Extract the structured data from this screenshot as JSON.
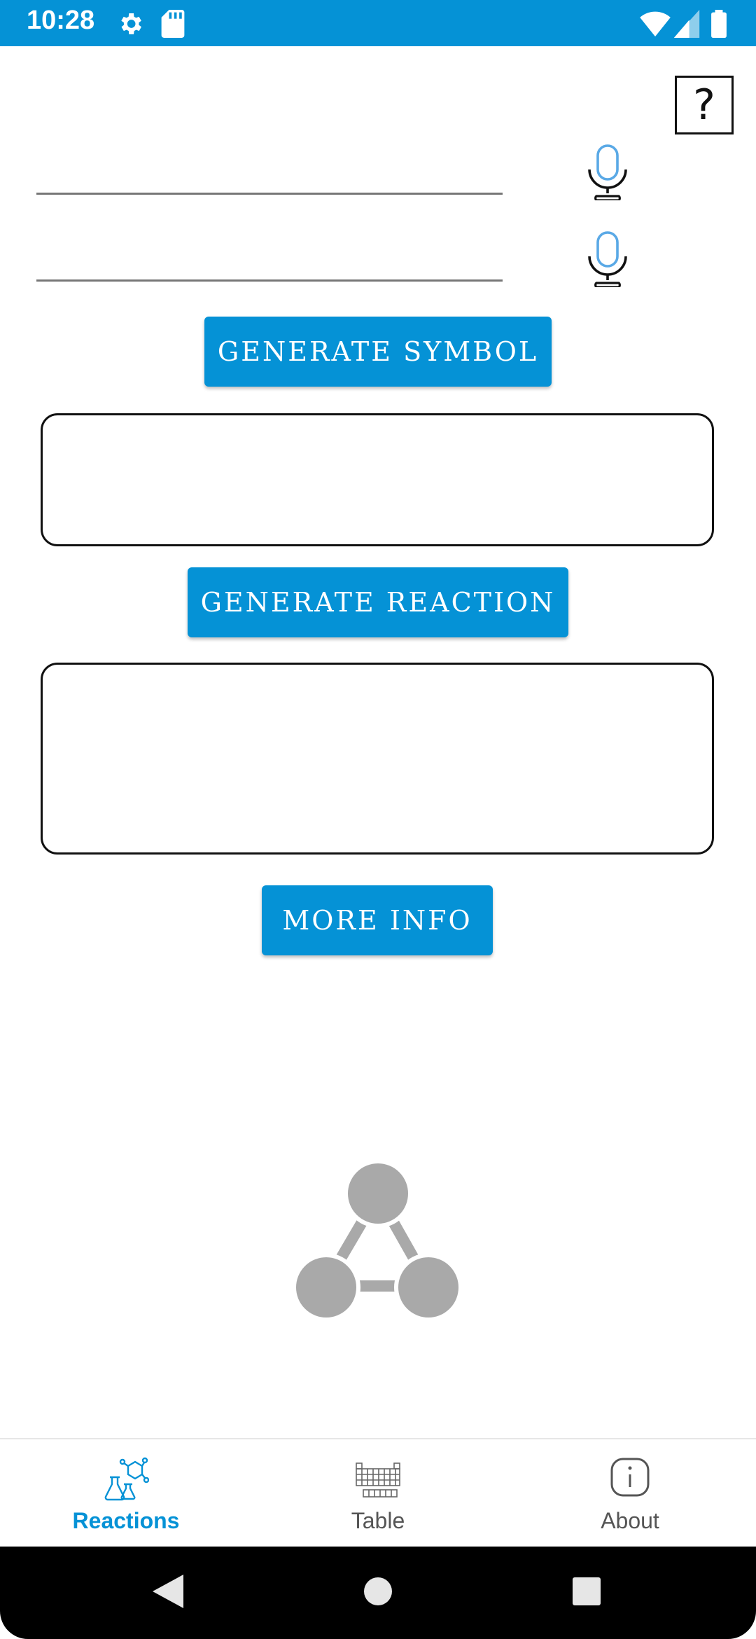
{
  "status_bar": {
    "time": "10:28",
    "icons": [
      "gear-icon",
      "sd-card-icon",
      "wifi-icon",
      "signal-icon",
      "battery-icon"
    ],
    "background": "#0592d6"
  },
  "header": {
    "help_label": "?"
  },
  "inputs": [
    {
      "value": "",
      "placeholder": ""
    },
    {
      "value": "",
      "placeholder": ""
    }
  ],
  "buttons": {
    "generate_symbol": "GENERATE SYMBOL",
    "generate_reaction": "GENERATE REACTION",
    "more_info": "MORE INFO"
  },
  "outputs": {
    "symbol": "",
    "reaction": ""
  },
  "bottom_nav": {
    "items": [
      {
        "label": "Reactions",
        "icon": "reactions-flask-icon",
        "active": true
      },
      {
        "label": "Table",
        "icon": "periodic-table-icon",
        "active": false
      },
      {
        "label": "About",
        "icon": "info-icon",
        "active": false
      }
    ]
  },
  "system_nav": {
    "icons": [
      "back-icon",
      "home-icon",
      "recents-icon"
    ]
  },
  "colors": {
    "accent": "#0592d6",
    "logo_gray": "#a9a9a9"
  }
}
